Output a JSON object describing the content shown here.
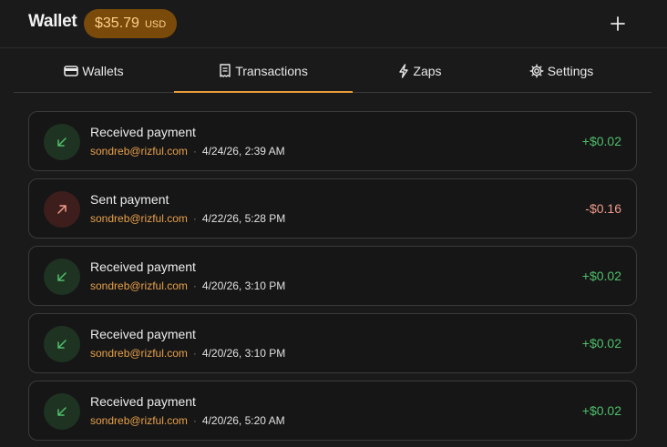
{
  "header": {
    "title": "Wallet",
    "balance_amount": "$35.79",
    "balance_unit": "USD",
    "add_icon": "plus-icon"
  },
  "tabs": [
    {
      "label": "Wallets",
      "icon": "wallet-icon",
      "active": false
    },
    {
      "label": "Transactions",
      "icon": "receipt-icon",
      "active": true
    },
    {
      "label": "Zaps",
      "icon": "bolt-icon",
      "active": false
    },
    {
      "label": "Settings",
      "icon": "gear-icon",
      "active": false
    }
  ],
  "transactions": [
    {
      "title": "Received payment",
      "address": "sondreb@rizful.com",
      "sep": "·",
      "date": "4/24/26, 2:39 AM",
      "amount": "+$0.02",
      "direction": "in"
    },
    {
      "title": "Sent payment",
      "address": "sondreb@rizful.com",
      "sep": "·",
      "date": "4/22/26, 5:28 PM",
      "amount": "-$0.16",
      "direction": "out"
    },
    {
      "title": "Received payment",
      "address": "sondreb@rizful.com",
      "sep": "·",
      "date": "4/20/26, 3:10 PM",
      "amount": "+$0.02",
      "direction": "in"
    },
    {
      "title": "Received payment",
      "address": "sondreb@rizful.com",
      "sep": "·",
      "date": "4/20/26, 3:10 PM",
      "amount": "+$0.02",
      "direction": "in"
    },
    {
      "title": "Received payment",
      "address": "sondreb@rizful.com",
      "sep": "·",
      "date": "4/20/26, 5:20 AM",
      "amount": "+$0.02",
      "direction": "in"
    }
  ],
  "colors": {
    "accent": "#e89a3c",
    "incoming": "#4fbf6a",
    "outgoing": "#ef9a8a",
    "address": "#e8a04a"
  }
}
